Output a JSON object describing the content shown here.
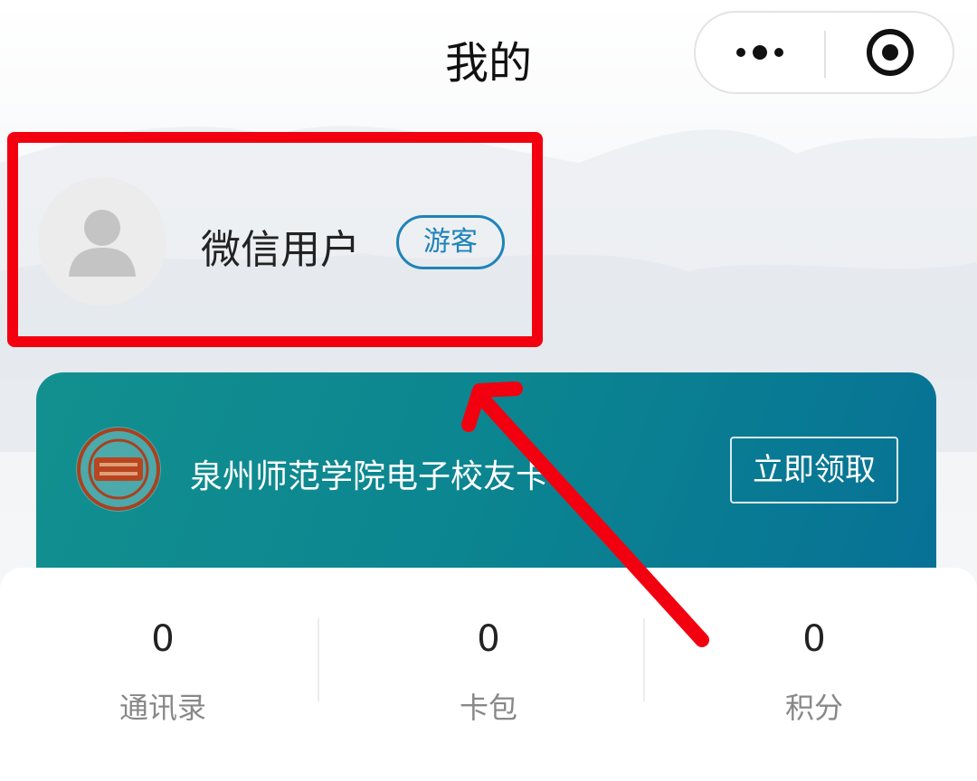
{
  "header": {
    "title": "我的",
    "more_icon": "more-dots-icon",
    "close_icon": "target-close-icon"
  },
  "user": {
    "name": "微信用户",
    "badge": "游客",
    "avatar_icon": "person-placeholder-icon"
  },
  "card": {
    "title": "泉州师范学院电子校友卡",
    "button": "立即领取",
    "logo_icon": "school-seal-icon"
  },
  "stats": [
    {
      "value": "0",
      "label": "通讯录"
    },
    {
      "value": "0",
      "label": "卡包"
    },
    {
      "value": "0",
      "label": "积分"
    }
  ],
  "colors": {
    "annotation_red": "#f2000f",
    "badge_blue": "#1f83b8",
    "card_teal": "#0b8590"
  }
}
